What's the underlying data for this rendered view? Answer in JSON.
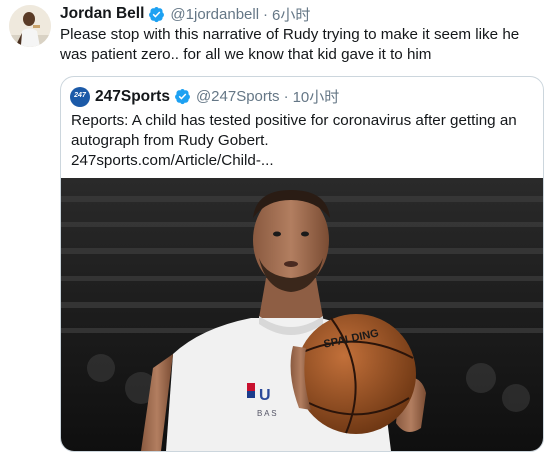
{
  "tweet": {
    "author_name": "Jordan Bell",
    "author_handle": "@1jordanbell",
    "separator": "·",
    "time": "6小时",
    "text": "Please stop with this narrative of Rudy trying to make it seem like he was patient zero.. for all we know that kid gave it to him",
    "verified_icon": "verified-badge-icon",
    "avatar_icon": "user-avatar"
  },
  "quote": {
    "author_name": "247Sports",
    "author_handle": "@247Sports",
    "separator": "·",
    "time": "10小时",
    "logo_text": "247",
    "text": "Reports: A child has tested positive for coronavirus after getting an autograph from Rudy Gobert.",
    "link": "247sports.com/Article/Child-...",
    "basketball_text": "SPALDING",
    "jersey_text": "B A S",
    "verified_icon": "verified-badge-icon"
  },
  "colors": {
    "text": "#14171a",
    "secondary": "#657786",
    "verified": "#1da1f2",
    "border": "#ccd6dd"
  }
}
